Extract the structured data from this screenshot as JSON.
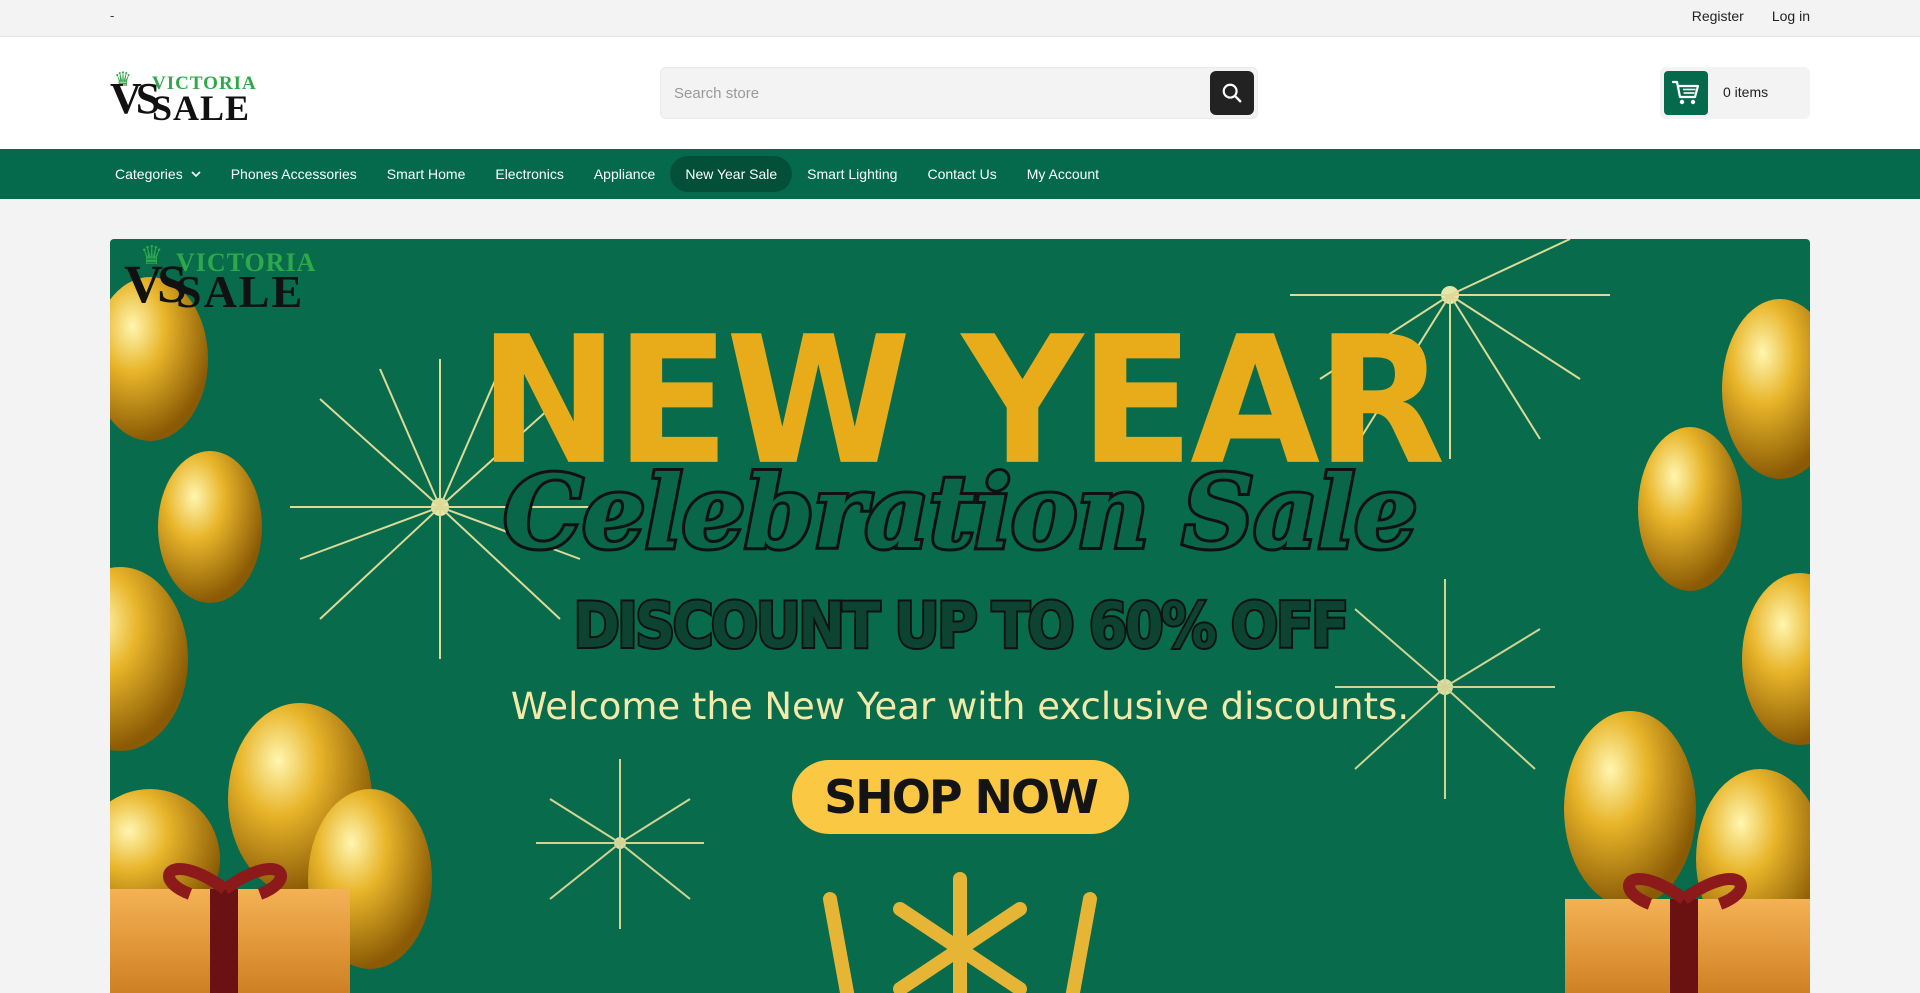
{
  "topbar": {
    "left_text": "-",
    "register_label": "Register",
    "login_label": "Log in"
  },
  "header": {
    "logo": {
      "top_word": "VICTORIA",
      "monogram": "VS",
      "bottom_word": "SALE"
    },
    "search": {
      "placeholder": "Search store",
      "button_icon": "search-icon"
    },
    "cart": {
      "icon": "shopping-cart-icon",
      "label": "0 items"
    }
  },
  "nav": {
    "items": [
      {
        "label": "Categories",
        "has_dropdown": true
      },
      {
        "label": "Phones Accessories"
      },
      {
        "label": "Smart Home"
      },
      {
        "label": "Electronics"
      },
      {
        "label": "Appliance"
      },
      {
        "label": "New Year Sale",
        "active": true
      },
      {
        "label": "Smart Lighting"
      },
      {
        "label": "Contact Us"
      },
      {
        "label": "My Account"
      }
    ]
  },
  "banner": {
    "logo": {
      "top_word": "VICTORIA",
      "monogram": "VS",
      "bottom_word": "SALE"
    },
    "headline": "NEW YEAR",
    "subheadline": "Celebration Sale",
    "discount": "DISCOUNT UP TO 60% OFF",
    "tagline": "Welcome the New Year with exclusive discounts.",
    "cta": "SHOP NOW"
  },
  "colors": {
    "brand_green": "#056a4b",
    "banner_bg": "#076b4c",
    "gold": "#e8ac1b",
    "cta_yellow": "#fbc843",
    "search_button": "#222222"
  }
}
